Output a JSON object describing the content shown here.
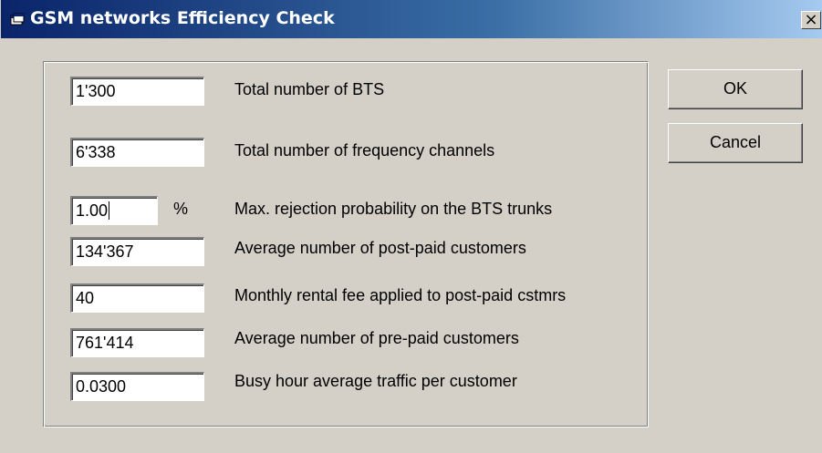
{
  "window": {
    "title": "GSM networks Efficiency Check",
    "close_glyph": "×"
  },
  "icons": {
    "app": "app-window-icon",
    "close": "close-icon"
  },
  "fields": [
    {
      "value": "1'300",
      "label": "Total number of BTS"
    },
    {
      "value": "6'338",
      "label": "Total number of frequency channels"
    },
    {
      "value": "1.00",
      "unit": "%",
      "label": "Max. rejection probability on the BTS trunks"
    },
    {
      "value": "134'367",
      "label": "Average number of post-paid customers"
    },
    {
      "value": "40",
      "label": "Monthly rental fee applied to post-paid cstmrs"
    },
    {
      "value": "761'414",
      "label": "Average number of pre-paid customers"
    },
    {
      "value": "0.0300",
      "label": "Busy hour average traffic per customer"
    }
  ],
  "buttons": {
    "ok": "OK",
    "cancel": "Cancel"
  },
  "colors": {
    "title_start": "#0a246a",
    "title_end": "#a6caf0",
    "face": "#d4d0c8"
  }
}
